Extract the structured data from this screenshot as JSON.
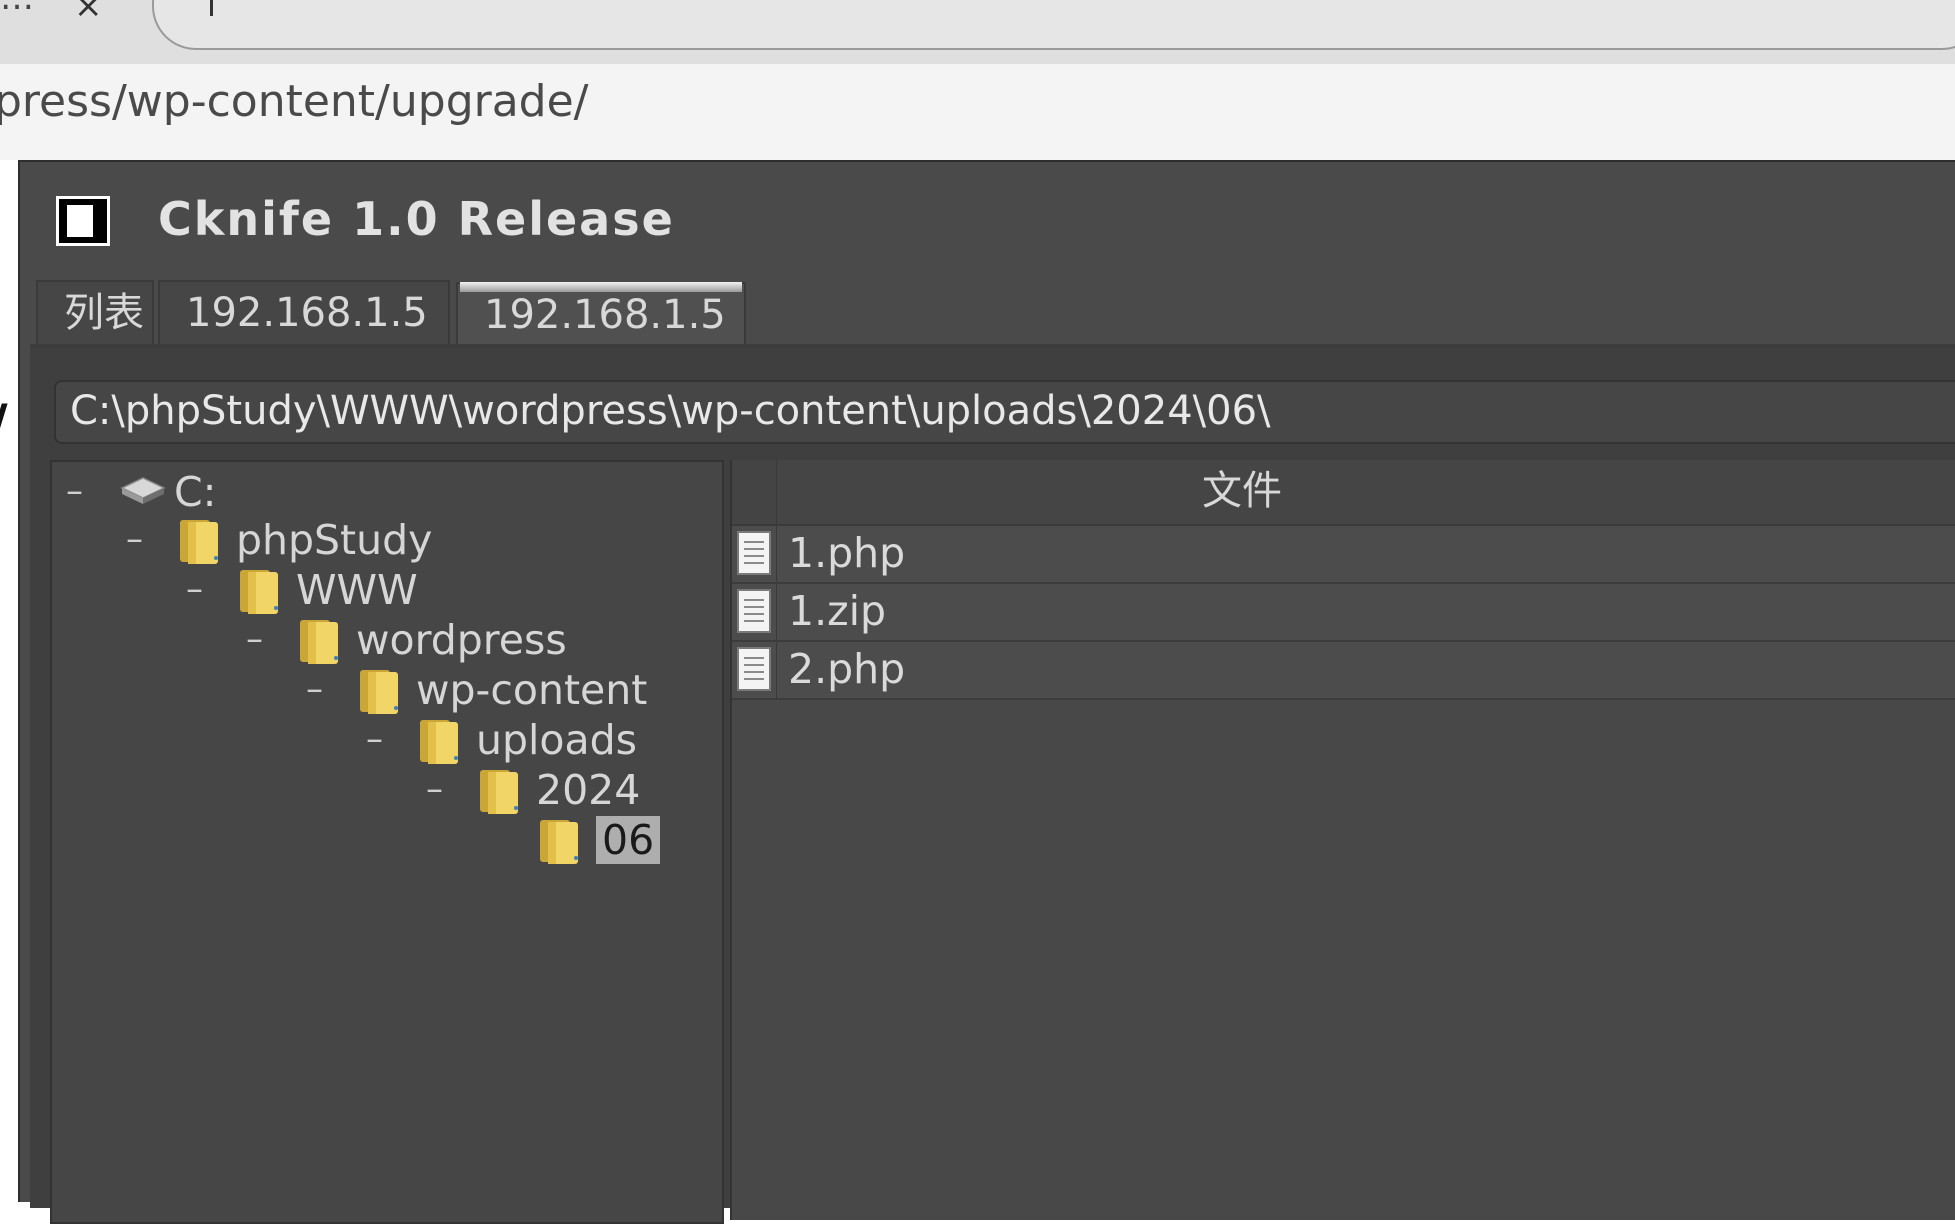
{
  "browser": {
    "url_fragment": "press/wp-content/upgrade/"
  },
  "window": {
    "title": "Cknife 1.0 Release"
  },
  "tabs": [
    {
      "label": "列表",
      "active": false
    },
    {
      "label": "192.168.1.5",
      "active": false
    },
    {
      "label": "192.168.1.5",
      "active": true
    }
  ],
  "path": "C:\\phpStudy\\WWW\\wordpress\\wp-content\\uploads\\2024\\06\\",
  "tree": {
    "root": {
      "expander": "–",
      "icon": "drive-icon",
      "label": "C:"
    },
    "nodes": [
      {
        "expander": "–",
        "icon": "folder-icon",
        "label": "phpStudy"
      },
      {
        "expander": "–",
        "icon": "folder-icon",
        "label": "WWW"
      },
      {
        "expander": "–",
        "icon": "folder-icon",
        "label": "wordpress"
      },
      {
        "expander": "–",
        "icon": "folder-icon",
        "label": "wp-content"
      },
      {
        "expander": "–",
        "icon": "folder-icon",
        "label": "uploads"
      },
      {
        "expander": "–",
        "icon": "folder-icon",
        "label": "2024"
      },
      {
        "expander": "",
        "icon": "folder-icon",
        "label": "06",
        "selected": true
      }
    ]
  },
  "file_table": {
    "column_header": "文件",
    "rows": [
      {
        "icon": "file-icon",
        "name": "1.php"
      },
      {
        "icon": "file-icon",
        "name": "1.zip"
      },
      {
        "icon": "file-icon",
        "name": "2.php"
      }
    ]
  },
  "colors": {
    "window_bg": "#4a4a4a",
    "panel_bg": "#464646",
    "text": "#d8d8d8",
    "selection": "#aeaeae",
    "folder": "#e8c84a"
  }
}
